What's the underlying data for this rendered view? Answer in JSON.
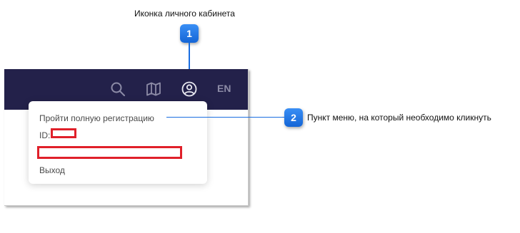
{
  "annotations": {
    "callout_1": {
      "number": "1",
      "caption": "Иконка личного кабинета"
    },
    "callout_2": {
      "number": "2",
      "caption": "Пункт меню, на который необходимо кликнуть"
    }
  },
  "topbar": {
    "icons": [
      "search-icon",
      "map-icon",
      "user-account-icon"
    ],
    "language": "EN",
    "background": "#23214a"
  },
  "account_menu": {
    "full_registration": "Пройти полную регистрацию",
    "id_label": "ID:",
    "logout": "Выход"
  },
  "colors": {
    "callout": "#1a6ee0",
    "redaction": "#e0202a"
  }
}
